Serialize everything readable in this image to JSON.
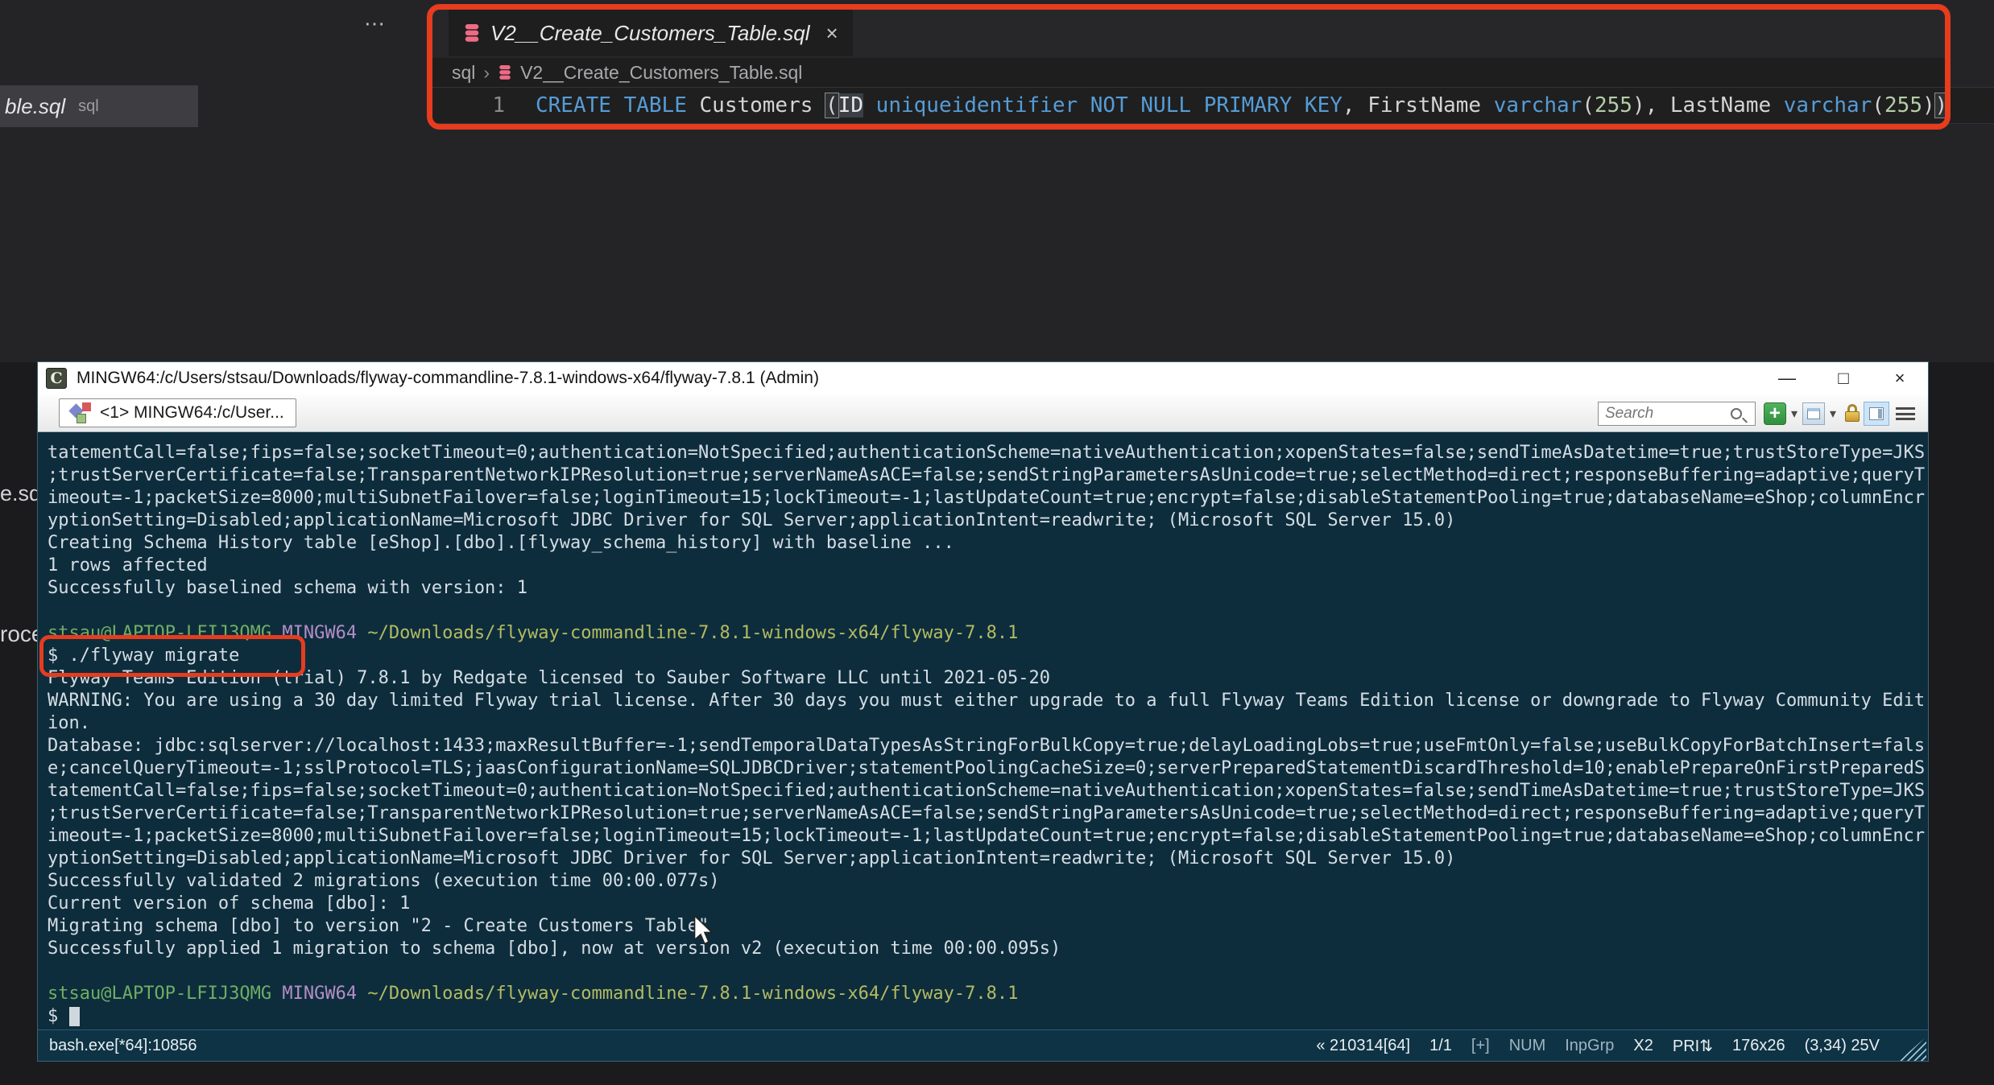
{
  "colors": {
    "annotation_red": "#e73c1e",
    "terminal_bg": "#0d2d3d",
    "status_bg": "#0e3345",
    "keyword_blue": "#569cd6",
    "number_green": "#b5cea8",
    "prompt_user_green": "#6fae63",
    "prompt_msys_purple": "#b48ec7",
    "prompt_path_olive": "#b4bb60",
    "db_icon_pink": "#ee6b86"
  },
  "editor": {
    "more_actions": "⋯",
    "left_fragment_file": "ble.sql",
    "left_fragment_lang": "sql",
    "left_fragment_2": "e.sq",
    "left_fragment_3": "roce",
    "tab": {
      "title": "V2__Create_Customers_Table.sql",
      "close": "×",
      "icon": "database-icon"
    },
    "breadcrumb": {
      "folder": "sql",
      "separator": "›",
      "file": "V2__Create_Customers_Table.sql"
    },
    "code": {
      "line_number": "1",
      "text": "CREATE TABLE Customers (ID uniqueidentifier NOT NULL PRIMARY KEY, FirstName varchar(255), LastName varchar(255))",
      "tokens": [
        [
          "k",
          "CREATE"
        ],
        [
          "d",
          " "
        ],
        [
          "k",
          "TABLE"
        ],
        [
          "d",
          " Customers "
        ],
        [
          "br",
          "("
        ],
        [
          "sel",
          "ID"
        ],
        [
          "d",
          " "
        ],
        [
          "k",
          "uniqueidentifier"
        ],
        [
          "d",
          " "
        ],
        [
          "k",
          "NOT"
        ],
        [
          "d",
          " "
        ],
        [
          "k",
          "NULL"
        ],
        [
          "d",
          " "
        ],
        [
          "k",
          "PRIMARY"
        ],
        [
          "d",
          " "
        ],
        [
          "k",
          "KEY"
        ],
        [
          "d",
          ", FirstName "
        ],
        [
          "k",
          "varchar"
        ],
        [
          "d",
          "("
        ],
        [
          "n",
          "255"
        ],
        [
          "d",
          "), LastName "
        ],
        [
          "k",
          "varchar"
        ],
        [
          "d",
          "("
        ],
        [
          "n",
          "255"
        ],
        [
          "d",
          ")"
        ],
        [
          "br",
          ")"
        ]
      ]
    }
  },
  "terminal": {
    "title": "MINGW64:/c/Users/stsau/Downloads/flyway-commandline-7.8.1-windows-x64/flyway-7.8.1 (Admin)",
    "window_controls": {
      "minimize": "—",
      "maximize": "□",
      "close": "×"
    },
    "tab_label": "<1> MINGW64:/c/User...",
    "toolbar": {
      "search_placeholder": "Search",
      "new_console": "+",
      "dropdown": "▾"
    },
    "lines": [
      [
        [
          "d",
          "tatementCall=false;fips=false;socketTimeout=0;authentication=NotSpecified;authenticationScheme=nativeAuthentication;xopenStates=false;sendTimeAsDatetime=true;trustStoreType=JKS"
        ]
      ],
      [
        [
          "d",
          ";trustServerCertificate=false;TransparentNetworkIPResolution=true;serverNameAsACE=false;sendStringParametersAsUnicode=true;selectMethod=direct;responseBuffering=adaptive;queryT"
        ]
      ],
      [
        [
          "d",
          "imeout=-1;packetSize=8000;multiSubnetFailover=false;loginTimeout=15;lockTimeout=-1;lastUpdateCount=true;encrypt=false;disableStatementPooling=true;databaseName=eShop;columnEncr"
        ]
      ],
      [
        [
          "d",
          "yptionSetting=Disabled;applicationName=Microsoft JDBC Driver for SQL Server;applicationIntent=readwrite; (Microsoft SQL Server 15.0)"
        ]
      ],
      [
        [
          "d",
          "Creating Schema History table [eShop].[dbo].[flyway_schema_history] with baseline ..."
        ]
      ],
      [
        [
          "d",
          "1 rows affected"
        ]
      ],
      [
        [
          "d",
          "Successfully baselined schema with version: 1"
        ]
      ],
      [],
      [
        [
          "g",
          "stsau@LAPTOP-LFIJ3QMG"
        ],
        [
          "d",
          " "
        ],
        [
          "p",
          "MINGW64"
        ],
        [
          "d",
          " "
        ],
        [
          "y",
          "~/Downloads/flyway-commandline-7.8.1-windows-x64/flyway-7.8.1"
        ]
      ],
      [
        [
          "d",
          "$ ./flyway migrate"
        ]
      ],
      [
        [
          "d",
          "Flyway Teams Edition (trial) 7.8.1 by Redgate licensed to Sauber Software LLC until 2021-05-20"
        ]
      ],
      [
        [
          "d",
          "WARNING: You are using a 30 day limited Flyway trial license. After 30 days you must either upgrade to a full Flyway Teams Edition license or downgrade to Flyway Community Edit"
        ]
      ],
      [
        [
          "d",
          "ion."
        ]
      ],
      [
        [
          "d",
          "Database: jdbc:sqlserver://localhost:1433;maxResultBuffer=-1;sendTemporalDataTypesAsStringForBulkCopy=true;delayLoadingLobs=true;useFmtOnly=false;useBulkCopyForBatchInsert=fals"
        ]
      ],
      [
        [
          "d",
          "e;cancelQueryTimeout=-1;sslProtocol=TLS;jaasConfigurationName=SQLJDBCDriver;statementPoolingCacheSize=0;serverPreparedStatementDiscardThreshold=10;enablePrepareOnFirstPreparedS"
        ]
      ],
      [
        [
          "d",
          "tatementCall=false;fips=false;socketTimeout=0;authentication=NotSpecified;authenticationScheme=nativeAuthentication;xopenStates=false;sendTimeAsDatetime=true;trustStoreType=JKS"
        ]
      ],
      [
        [
          "d",
          ";trustServerCertificate=false;TransparentNetworkIPResolution=true;serverNameAsACE=false;sendStringParametersAsUnicode=true;selectMethod=direct;responseBuffering=adaptive;queryT"
        ]
      ],
      [
        [
          "d",
          "imeout=-1;packetSize=8000;multiSubnetFailover=false;loginTimeout=15;lockTimeout=-1;lastUpdateCount=true;encrypt=false;disableStatementPooling=true;databaseName=eShop;columnEncr"
        ]
      ],
      [
        [
          "d",
          "yptionSetting=Disabled;applicationName=Microsoft JDBC Driver for SQL Server;applicationIntent=readwrite; (Microsoft SQL Server 15.0)"
        ]
      ],
      [
        [
          "d",
          "Successfully validated 2 migrations (execution time 00:00.077s)"
        ]
      ],
      [
        [
          "d",
          "Current version of schema [dbo]: 1"
        ]
      ],
      [
        [
          "d",
          "Migrating schema [dbo] to version \"2 - Create Customers Table\""
        ]
      ],
      [
        [
          "d",
          "Successfully applied 1 migration to schema [dbo], now at version v2 (execution time 00:00.095s)"
        ]
      ],
      [],
      [
        [
          "g",
          "stsau@LAPTOP-LFIJ3QMG"
        ],
        [
          "d",
          " "
        ],
        [
          "p",
          "MINGW64"
        ],
        [
          "d",
          " "
        ],
        [
          "y",
          "~/Downloads/flyway-commandline-7.8.1-windows-x64/flyway-7.8.1"
        ]
      ],
      [
        [
          "d",
          "$ "
        ],
        [
          "cur",
          " "
        ]
      ]
    ],
    "status_bar": {
      "left": "bash.exe[*64]:10856",
      "right": [
        {
          "t": "« 210314[64]"
        },
        {
          "t": "1/1"
        },
        {
          "t": "[+]",
          "dim": true
        },
        {
          "t": "NUM",
          "dim": true
        },
        {
          "t": "InpGrp",
          "dim": true
        },
        {
          "t": "X2"
        },
        {
          "t": "PRI⇅"
        },
        {
          "t": "176x26"
        },
        {
          "t": "(3,34) 25V"
        }
      ]
    }
  }
}
